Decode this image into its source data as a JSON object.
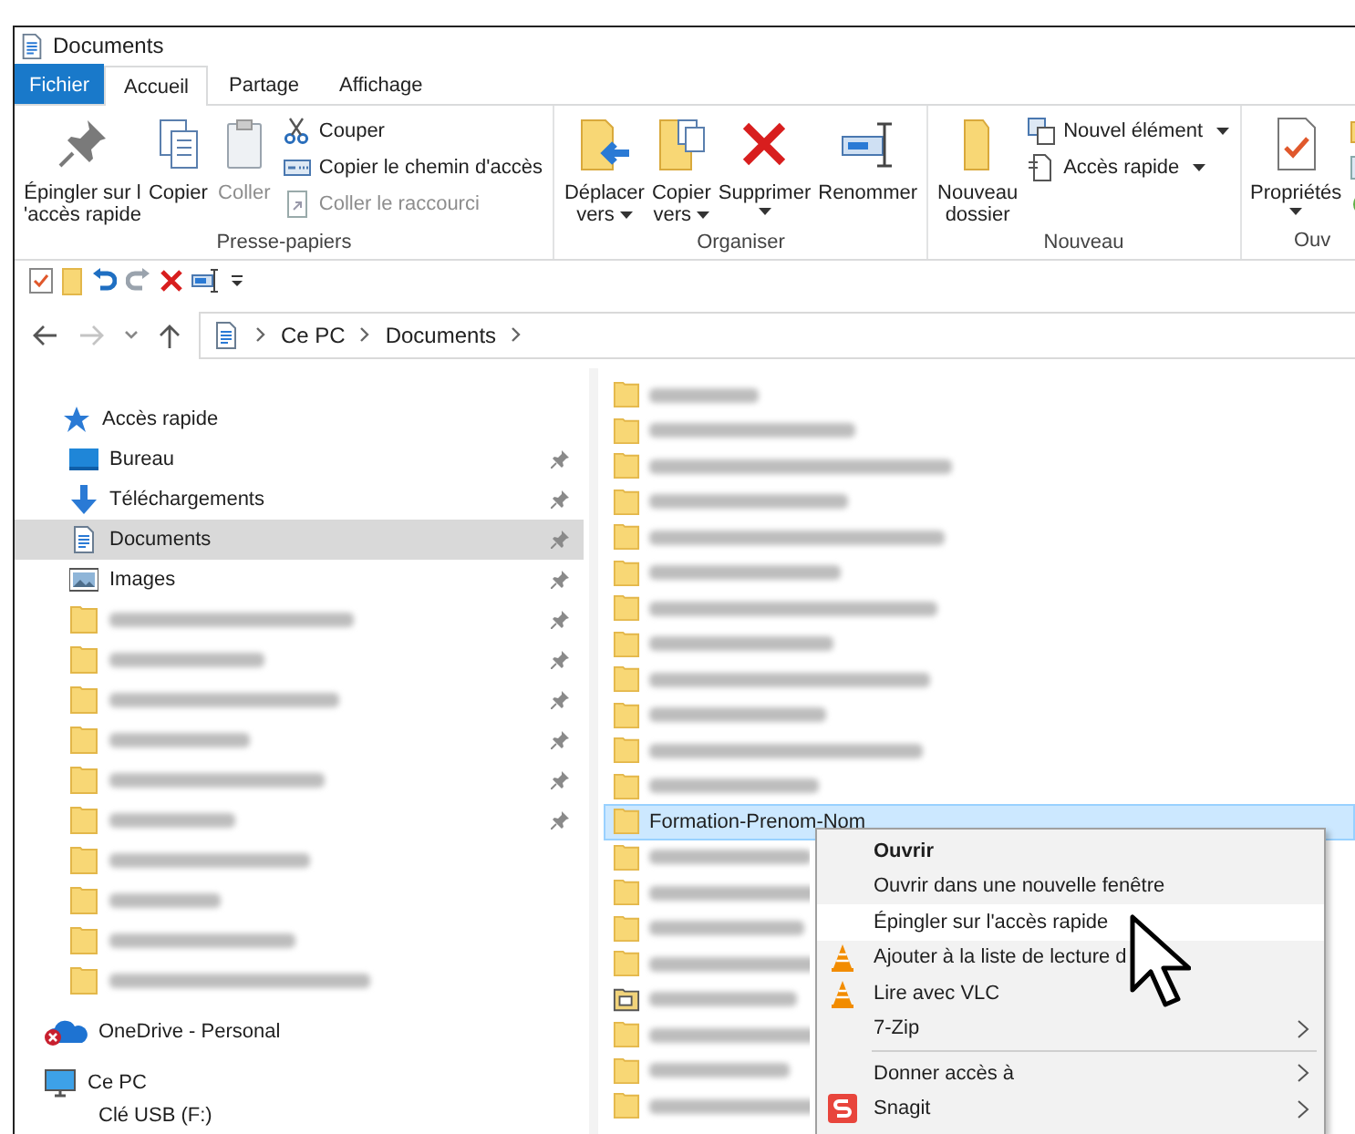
{
  "window": {
    "title": "Documents"
  },
  "ribbon_tabs": [
    {
      "label": "Fichier",
      "kind": "file",
      "selected": false
    },
    {
      "label": "Accueil",
      "kind": "tab",
      "selected": true
    },
    {
      "label": "Partage",
      "kind": "tab",
      "selected": false
    },
    {
      "label": "Affichage",
      "kind": "tab",
      "selected": false
    }
  ],
  "ribbon_groups": [
    {
      "label": "Presse-papiers",
      "commands": [
        {
          "kind": "large",
          "lines": [
            "Épingler sur l",
            "'accès rapide"
          ],
          "disabled": false,
          "dropdown": false
        },
        {
          "kind": "large",
          "lines": [
            "Copier"
          ],
          "disabled": false,
          "dropdown": false
        },
        {
          "kind": "large",
          "lines": [
            "Coller"
          ],
          "disabled": true,
          "dropdown": false
        },
        {
          "kind": "stack",
          "items": [
            {
              "label": "Couper",
              "disabled": false,
              "dropdown": false
            },
            {
              "label": "Copier le chemin d'accès",
              "disabled": false,
              "dropdown": false
            },
            {
              "label": "Coller le raccourci",
              "disabled": true,
              "dropdown": false
            }
          ]
        }
      ]
    },
    {
      "label": "Organiser",
      "commands": [
        {
          "kind": "large",
          "lines": [
            "Déplacer",
            "vers"
          ],
          "disabled": false,
          "dropdown": true
        },
        {
          "kind": "large",
          "lines": [
            "Copier",
            "vers"
          ],
          "disabled": false,
          "dropdown": true
        },
        {
          "kind": "large",
          "lines": [
            "Supprimer"
          ],
          "disabled": false,
          "dropdown": true
        },
        {
          "kind": "large",
          "lines": [
            "Renommer"
          ],
          "disabled": false,
          "dropdown": false
        }
      ]
    },
    {
      "label": "Nouveau",
      "commands": [
        {
          "kind": "large",
          "lines": [
            "Nouveau",
            "dossier"
          ],
          "disabled": false,
          "dropdown": false
        },
        {
          "kind": "stack",
          "items": [
            {
              "label": "Nouvel élément",
              "disabled": false,
              "dropdown": true
            },
            {
              "label": "Accès rapide",
              "disabled": false,
              "dropdown": true
            }
          ]
        }
      ]
    },
    {
      "label": "Ouv",
      "commands": [
        {
          "kind": "large",
          "lines": [
            "Propriétés"
          ],
          "disabled": false,
          "dropdown": true
        }
      ]
    }
  ],
  "address_bar": {
    "path": [
      "Ce PC",
      "Documents"
    ]
  },
  "navigation_pane": {
    "items": [
      {
        "label": "Accès rapide",
        "selected": false,
        "children": [
          {
            "label": "Bureau",
            "kind": "named",
            "pinned": true,
            "selected": false
          },
          {
            "label": "Téléchargements",
            "kind": "named",
            "pinned": true,
            "selected": false
          },
          {
            "label": "Documents",
            "kind": "named",
            "pinned": true,
            "selected": true
          },
          {
            "label": "Images",
            "kind": "named",
            "pinned": true,
            "selected": false
          },
          {
            "kind": "blurred",
            "pinned": true,
            "selected": false
          },
          {
            "kind": "blurred",
            "pinned": true,
            "selected": false
          },
          {
            "kind": "blurred",
            "pinned": true,
            "selected": false
          },
          {
            "kind": "blurred",
            "pinned": true,
            "selected": false
          },
          {
            "kind": "blurred",
            "pinned": true,
            "selected": false
          },
          {
            "kind": "blurred",
            "pinned": true,
            "selected": false
          },
          {
            "kind": "blurred",
            "pinned": false,
            "selected": false
          },
          {
            "kind": "blurred",
            "pinned": false,
            "selected": false
          },
          {
            "kind": "blurred",
            "pinned": false,
            "selected": false
          },
          {
            "kind": "blurred",
            "pinned": false,
            "selected": false
          }
        ]
      },
      {
        "label": "OneDrive - Personal",
        "selected": false
      },
      {
        "label": "Ce PC",
        "selected": false
      },
      {
        "label": "Clé USB (F:)",
        "selected": false
      }
    ]
  },
  "files": [
    {
      "kind": "blurred",
      "selected": false
    },
    {
      "kind": "blurred",
      "selected": false
    },
    {
      "kind": "blurred",
      "selected": false
    },
    {
      "kind": "blurred",
      "selected": false
    },
    {
      "kind": "blurred",
      "selected": false
    },
    {
      "kind": "blurred",
      "selected": false
    },
    {
      "kind": "blurred",
      "selected": false
    },
    {
      "kind": "blurred",
      "selected": false
    },
    {
      "kind": "blurred",
      "selected": false
    },
    {
      "kind": "blurred",
      "selected": false
    },
    {
      "kind": "blurred",
      "selected": false
    },
    {
      "kind": "blurred",
      "selected": false
    },
    {
      "kind": "named",
      "name": "Formation-Prenom-Nom",
      "selected": true
    },
    {
      "kind": "blurred",
      "selected": false
    },
    {
      "kind": "blurred",
      "selected": false
    },
    {
      "kind": "blurred",
      "selected": false
    },
    {
      "kind": "blurred",
      "selected": false
    },
    {
      "kind": "shared",
      "selected": false
    },
    {
      "kind": "blurred",
      "selected": false
    },
    {
      "kind": "blurred",
      "selected": false
    },
    {
      "kind": "blurred",
      "selected": false
    }
  ],
  "context_menu": {
    "items": [
      {
        "kind": "item",
        "label": "Ouvrir",
        "default": true,
        "submenu": false,
        "selected": false
      },
      {
        "kind": "item",
        "label": "Ouvrir dans une nouvelle fenêtre",
        "default": false,
        "submenu": false,
        "selected": false
      },
      {
        "kind": "item",
        "label": "Épingler sur l'accès rapide",
        "default": false,
        "submenu": false,
        "selected": true
      },
      {
        "kind": "item",
        "label": "Ajouter à la liste de lecture d",
        "default": false,
        "submenu": false,
        "selected": false
      },
      {
        "kind": "item",
        "label": "Lire avec VLC",
        "default": false,
        "submenu": false,
        "selected": false
      },
      {
        "kind": "item",
        "label": "7-Zip",
        "default": false,
        "submenu": true,
        "selected": false
      },
      {
        "kind": "separator"
      },
      {
        "kind": "item",
        "label": "Donner accès à",
        "default": false,
        "submenu": true,
        "selected": false
      },
      {
        "kind": "item",
        "label": "Snagit",
        "default": false,
        "submenu": true,
        "selected": false
      }
    ]
  }
}
